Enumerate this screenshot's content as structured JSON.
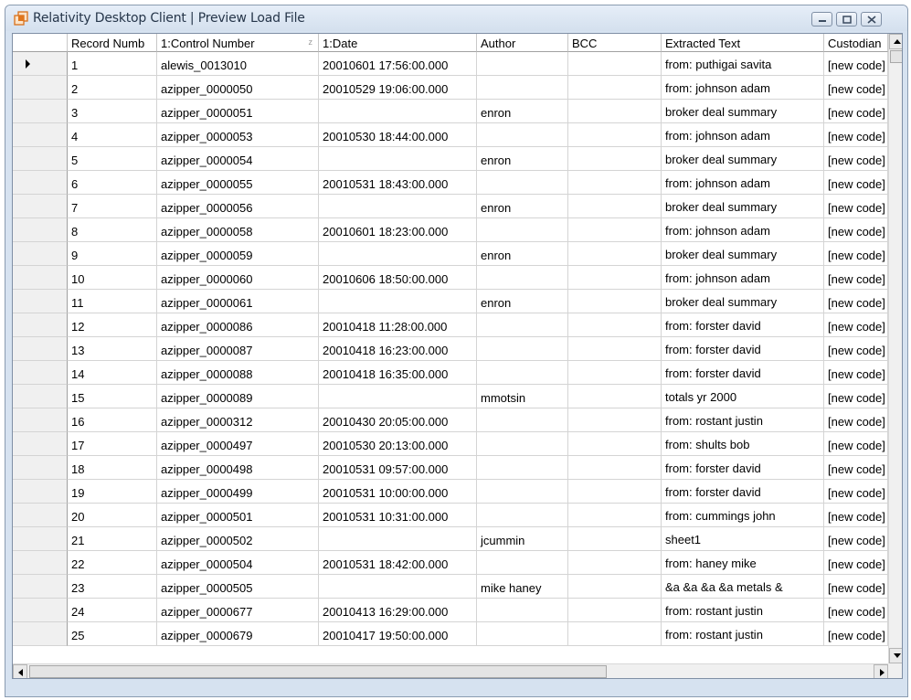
{
  "window": {
    "title": "Relativity Desktop Client | Preview Load File",
    "app_icon": "relativity-app-icon",
    "controls": [
      "minimize-icon",
      "maximize-icon",
      "close-icon"
    ]
  },
  "grid": {
    "columns": [
      {
        "label": "Record Numb"
      },
      {
        "label": "1:Control Number",
        "sort_glyph": "z"
      },
      {
        "label": "1:Date"
      },
      {
        "label": "Author"
      },
      {
        "label": "BCC"
      },
      {
        "label": "Extracted Text"
      },
      {
        "label": "Custodian"
      }
    ],
    "current_row_index": 0,
    "rows": [
      {
        "record": "1",
        "control": "alewis_0013010",
        "date": "20010601 17:56:00.000",
        "author": "",
        "bcc": "",
        "text": "from:  puthigai  savita",
        "custodian": "[new code]"
      },
      {
        "record": "2",
        "control": "azipper_0000050",
        "date": "20010529 19:06:00.000",
        "author": "",
        "bcc": "",
        "text": "from:  johnson  adam",
        "custodian": "[new code]"
      },
      {
        "record": "3",
        "control": "azipper_0000051",
        "date": "",
        "author": "enron",
        "bcc": "",
        "text": "broker deal summary",
        "custodian": "[new code]"
      },
      {
        "record": "4",
        "control": "azipper_0000053",
        "date": "20010530 18:44:00.000",
        "author": "",
        "bcc": "",
        "text": "from:  johnson  adam",
        "custodian": "[new code]"
      },
      {
        "record": "5",
        "control": "azipper_0000054",
        "date": "",
        "author": "enron",
        "bcc": "",
        "text": "broker deal summary",
        "custodian": "[new code]"
      },
      {
        "record": "6",
        "control": "azipper_0000055",
        "date": "20010531 18:43:00.000",
        "author": "",
        "bcc": "",
        "text": "from:  johnson  adam",
        "custodian": "[new code]"
      },
      {
        "record": "7",
        "control": "azipper_0000056",
        "date": "",
        "author": "enron",
        "bcc": "",
        "text": "broker deal summary",
        "custodian": "[new code]"
      },
      {
        "record": "8",
        "control": "azipper_0000058",
        "date": "20010601 18:23:00.000",
        "author": "",
        "bcc": "",
        "text": "from:  johnson  adam",
        "custodian": "[new code]"
      },
      {
        "record": "9",
        "control": "azipper_0000059",
        "date": "",
        "author": "enron",
        "bcc": "",
        "text": "broker deal summary",
        "custodian": "[new code]"
      },
      {
        "record": "10",
        "control": "azipper_0000060",
        "date": "20010606 18:50:00.000",
        "author": "",
        "bcc": "",
        "text": "from:  johnson  adam",
        "custodian": "[new code]"
      },
      {
        "record": "11",
        "control": "azipper_0000061",
        "date": "",
        "author": "enron",
        "bcc": "",
        "text": "broker deal summary",
        "custodian": "[new code]"
      },
      {
        "record": "12",
        "control": "azipper_0000086",
        "date": "20010418 11:28:00.000",
        "author": "",
        "bcc": "",
        "text": "from:  forster  david",
        "custodian": "[new code]"
      },
      {
        "record": "13",
        "control": "azipper_0000087",
        "date": "20010418 16:23:00.000",
        "author": "",
        "bcc": "",
        "text": "from:  forster  david",
        "custodian": "[new code]"
      },
      {
        "record": "14",
        "control": "azipper_0000088",
        "date": "20010418 16:35:00.000",
        "author": "",
        "bcc": "",
        "text": "from:  forster  david",
        "custodian": "[new code]"
      },
      {
        "record": "15",
        "control": "azipper_0000089",
        "date": "",
        "author": "mmotsin",
        "bcc": "",
        "text": "totals  yr  2000",
        "custodian": "[new code]"
      },
      {
        "record": "16",
        "control": "azipper_0000312",
        "date": "20010430 20:05:00.000",
        "author": "",
        "bcc": "",
        "text": "from:  rostant  justin",
        "custodian": "[new code]"
      },
      {
        "record": "17",
        "control": "azipper_0000497",
        "date": "20010530 20:13:00.000",
        "author": "",
        "bcc": "",
        "text": "from:  shults  bob",
        "custodian": "[new code]"
      },
      {
        "record": "18",
        "control": "azipper_0000498",
        "date": "20010531 09:57:00.000",
        "author": "",
        "bcc": "",
        "text": "from:  forster  david",
        "custodian": "[new code]"
      },
      {
        "record": "19",
        "control": "azipper_0000499",
        "date": "20010531 10:00:00.000",
        "author": "",
        "bcc": "",
        "text": "from:  forster  david",
        "custodian": "[new code]"
      },
      {
        "record": "20",
        "control": "azipper_0000501",
        "date": "20010531 10:31:00.000",
        "author": "",
        "bcc": "",
        "text": "from:  cummings  john",
        "custodian": "[new code]"
      },
      {
        "record": "21",
        "control": "azipper_0000502",
        "date": "",
        "author": "jcummin",
        "bcc": "",
        "text": "sheet1",
        "custodian": "[new code]"
      },
      {
        "record": "22",
        "control": "azipper_0000504",
        "date": "20010531 18:42:00.000",
        "author": "",
        "bcc": "",
        "text": "from:  haney  mike",
        "custodian": "[new code]"
      },
      {
        "record": "23",
        "control": "azipper_0000505",
        "date": "",
        "author": "mike haney",
        "bcc": "",
        "text": " &a &a &a &a metals &",
        "custodian": "[new code]"
      },
      {
        "record": "24",
        "control": "azipper_0000677",
        "date": "20010413 16:29:00.000",
        "author": "",
        "bcc": "",
        "text": "from:  rostant  justin",
        "custodian": "[new code]"
      },
      {
        "record": "25",
        "control": "azipper_0000679",
        "date": "20010417 19:50:00.000",
        "author": "",
        "bcc": "",
        "text": "from:  rostant  justin",
        "custodian": "[new code]"
      }
    ]
  },
  "scrollbars": {
    "vertical": {
      "up_icon": "scroll-up-arrow-icon",
      "down_icon": "scroll-down-arrow-icon",
      "position": 0
    },
    "horizontal": {
      "left_icon": "scroll-left-arrow-icon",
      "right_icon": "scroll-right-arrow-icon",
      "position": 0
    }
  },
  "colors": {
    "title_bar": "#dae5f2",
    "header_bg": "#ffffff",
    "selector_bg": "#f0f0f0",
    "grid_line": "#d4d4d4",
    "app_icon_accent": "#e0761d"
  }
}
